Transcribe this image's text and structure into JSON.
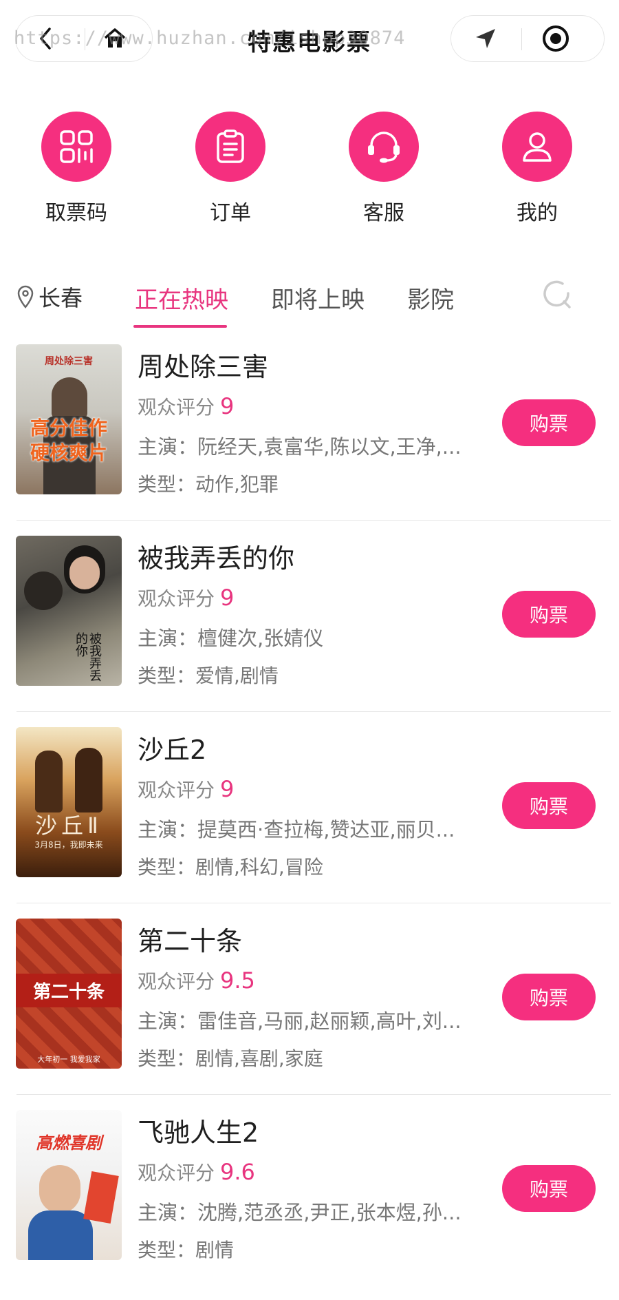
{
  "header": {
    "title": "特惠电影票",
    "watermark": "https://www.huzhan.com/ishop30874"
  },
  "quick_menu": [
    {
      "label": "取票码",
      "icon": "ticket-code-icon"
    },
    {
      "label": "订单",
      "icon": "clipboard-icon"
    },
    {
      "label": "客服",
      "icon": "headset-icon"
    },
    {
      "label": "我的",
      "icon": "user-icon"
    }
  ],
  "tabs": {
    "city": "长春",
    "items": [
      "正在热映",
      "即将上映",
      "影院"
    ],
    "active": "正在热映"
  },
  "labels": {
    "score": "观众评分",
    "cast": "主演：",
    "genre": "类型：",
    "buy": "购票"
  },
  "movies": [
    {
      "title": "周处除三害",
      "score": "9",
      "cast": "阮经天,袁富华,陈以文,王净,...",
      "genre": "动作,犯罪",
      "poster_text": "高分佳作\n硬核爽片",
      "poster_top": "周处除三害"
    },
    {
      "title": "被我弄丢的你",
      "score": "9",
      "cast": "檀健次,张婧仪",
      "genre": "爱情,剧情",
      "poster_text": "被我弄丢的你",
      "poster_top": ""
    },
    {
      "title": "沙丘2",
      "score": "9",
      "cast": "提莫西·查拉梅,赞达亚,丽贝...",
      "genre": "剧情,科幻,冒险",
      "poster_text": "沙丘Ⅱ",
      "poster_top": "3月8日，我即未来"
    },
    {
      "title": "第二十条",
      "score": "9.5",
      "cast": "雷佳音,马丽,赵丽颖,高叶,刘...",
      "genre": "剧情,喜剧,家庭",
      "poster_text": "第二十条",
      "poster_top": "大年初一 我爱我家"
    },
    {
      "title": "飞驰人生2",
      "score": "9.6",
      "cast": "沈腾,范丞丞,尹正,张本煜,孙...",
      "genre": "剧情",
      "poster_text": "高燃喜剧",
      "poster_top": ""
    }
  ],
  "colors": {
    "accent": "#f52f7f",
    "tab_active": "#e8357f"
  }
}
